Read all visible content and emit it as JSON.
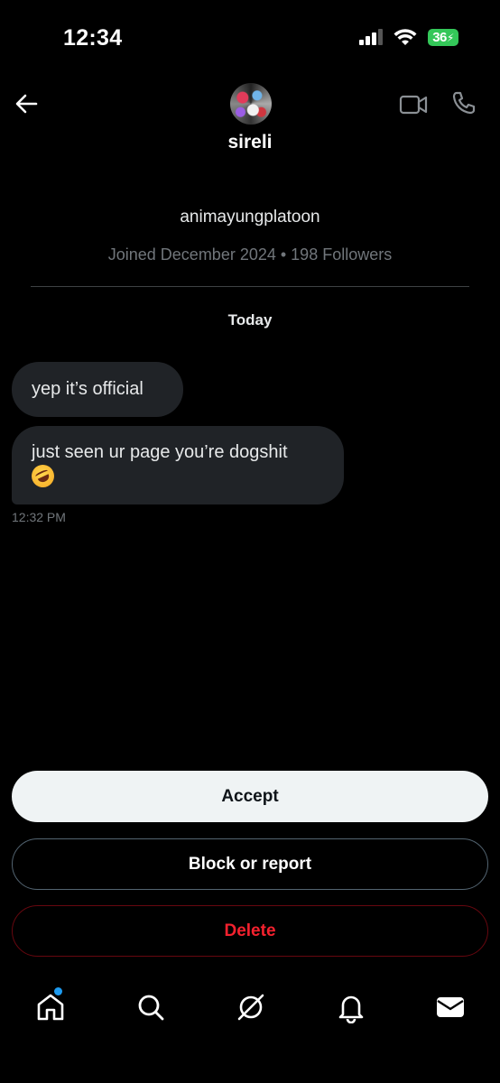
{
  "status_bar": {
    "time": "12:34",
    "battery": "36"
  },
  "header": {
    "name": "sireli",
    "icons": {
      "back": "arrow-left-icon",
      "video": "video-camera-icon",
      "call": "phone-icon"
    }
  },
  "profile": {
    "handle": "animayungplatoon",
    "meta": "Joined December 2024 • 198 Followers"
  },
  "conversation": {
    "day_label": "Today",
    "messages": [
      {
        "text": "yep it’s official"
      },
      {
        "text": "just seen ur page you’re dogshit",
        "emoji": "rolling-on-floor-laughing-emoji"
      }
    ],
    "timestamp": "12:32 PM"
  },
  "actions": {
    "accept": "Accept",
    "block": "Block or report",
    "delete": "Delete"
  },
  "tabbar": {
    "items": [
      "home-icon",
      "search-icon",
      "grok-icon",
      "notifications-bell-icon",
      "messages-envelope-icon"
    ],
    "home_has_badge": true
  },
  "colors": {
    "background": "#000000",
    "bubble": "#202327",
    "secondary_text": "#71767b",
    "accept_bg": "#eff3f4",
    "delete_text": "#f4212e",
    "badge": "#1d9bf0",
    "battery": "#34c759"
  }
}
